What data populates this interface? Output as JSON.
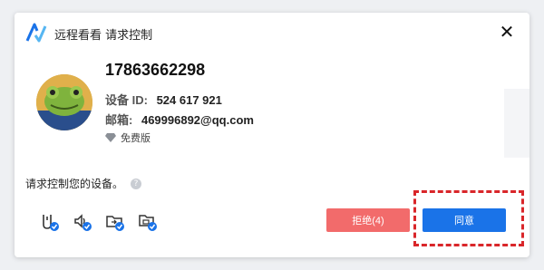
{
  "window": {
    "title": "远程看看 请求控制",
    "close_glyph": "✕"
  },
  "requester": {
    "phone": "17863662298",
    "device_id_label": "设备 ID:",
    "device_id": "524 617 921",
    "email_label": "邮箱:",
    "email": "469996892@qq.com",
    "version": "免费版"
  },
  "request": {
    "message": "请求控制您的设备。",
    "help_glyph": "?"
  },
  "permissions": [
    {
      "name": "screen-control-icon"
    },
    {
      "name": "audio-icon"
    },
    {
      "name": "file-transfer-icon"
    },
    {
      "name": "clipboard-icon"
    }
  ],
  "actions": {
    "reject_label": "拒绝(4)",
    "accept_label": "同意"
  },
  "colors": {
    "accept": "#1a73e8",
    "reject": "#f26b6b",
    "highlight": "#d9262a",
    "logo": "#1a73e8"
  }
}
